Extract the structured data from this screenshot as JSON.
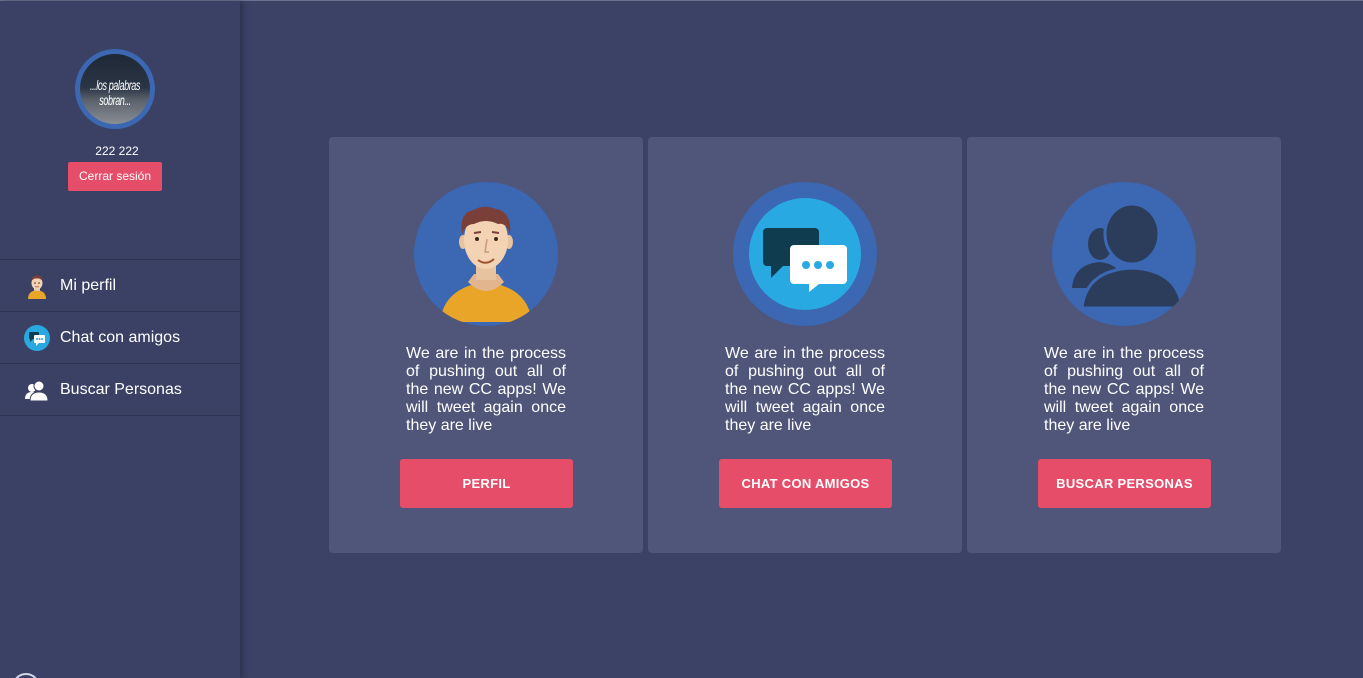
{
  "sidebar": {
    "avatar_text": "...los palabras sobran...",
    "username": "222 222",
    "logout_label": "Cerrar sesión",
    "nav": [
      {
        "label": "Mi perfil",
        "icon": "user-face-icon"
      },
      {
        "label": "Chat con amigos",
        "icon": "chat-bubbles-icon"
      },
      {
        "label": "Buscar Personas",
        "icon": "people-icon"
      }
    ]
  },
  "cards": [
    {
      "icon": "user-face-icon",
      "text": "We are in the process of pushing out all of the new CC apps! We will tweet again once they are live",
      "button": "PERFIL"
    },
    {
      "icon": "chat-bubbles-icon",
      "text": "We are in the process of pushing out all of the new CC apps! We will tweet again once they are live",
      "button": "CHAT CON AMIGOS"
    },
    {
      "icon": "people-icon",
      "text": "We are in the process of pushing out all of the new CC apps! We will tweet again once they are live",
      "button": "BUSCAR PERSONAS"
    }
  ],
  "colors": {
    "background": "#3b4266",
    "sidebar": "#3a4164",
    "card": "#4f5679",
    "accent": "#e54d69",
    "icon_circle": "#3b67b3"
  }
}
